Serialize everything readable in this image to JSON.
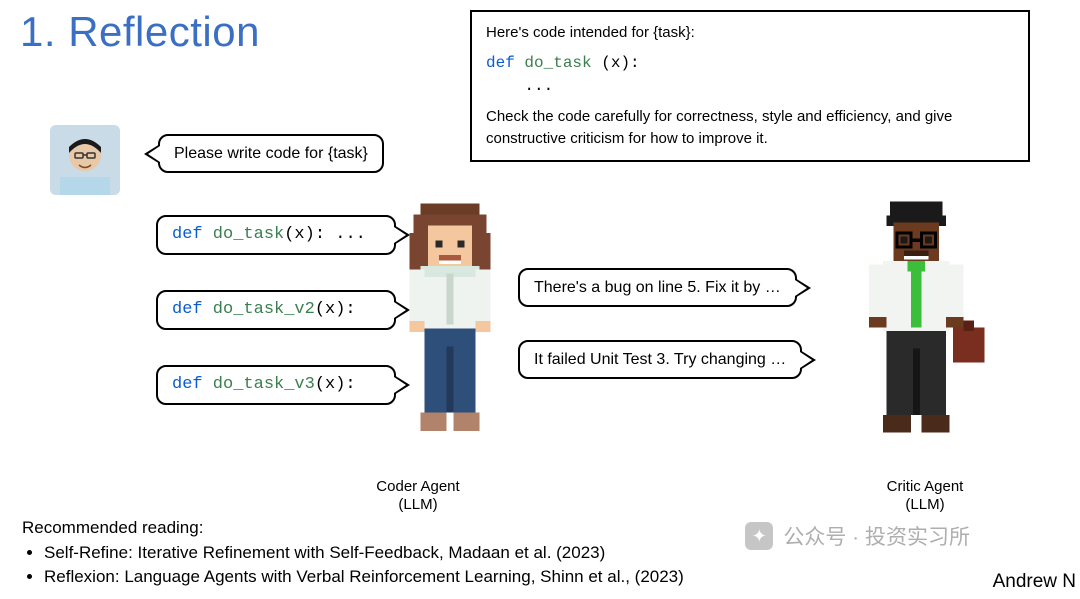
{
  "title": "1. Reflection",
  "instruction": {
    "intro": "Here's code intended for {task}:",
    "code_kw": "def",
    "code_fn": " do_task ",
    "code_rest": "(x):",
    "code_indent": "    ...",
    "check": "Check the code carefully for correctness, style and efficiency, and give constructive criticism for how to improve it."
  },
  "user_prompt": "Please write code for {task}",
  "coder_bubbles": [
    {
      "kw": "def",
      "fn": " do_task",
      "rest": "(x): ..."
    },
    {
      "kw": "def",
      "fn": " do_task_v2",
      "rest": "(x):"
    },
    {
      "kw": "def",
      "fn": " do_task_v3",
      "rest": "(x):"
    }
  ],
  "critic_bubbles": [
    "There's a bug on line 5. Fix it by …",
    "It failed Unit Test 3. Try changing …"
  ],
  "labels": {
    "coder": "Coder Agent",
    "coder_sub": "(LLM)",
    "critic": "Critic Agent",
    "critic_sub": "(LLM)"
  },
  "reading": {
    "heading": "Recommended reading:",
    "items": [
      "Self-Refine: Iterative Refinement with Self-Feedback, Madaan et al. (2023)",
      "Reflexion: Language Agents with Verbal Reinforcement Learning, Shinn et al., (2023)"
    ]
  },
  "author": "Andrew N",
  "watermark": {
    "label": "公众号 · 投资实习所"
  }
}
